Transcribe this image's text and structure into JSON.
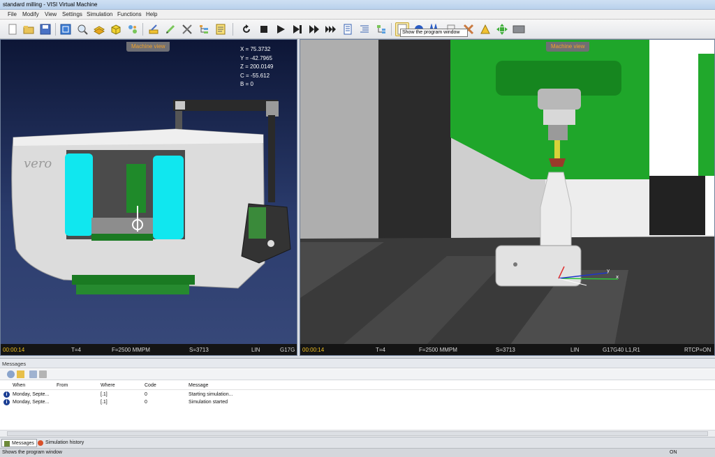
{
  "window": {
    "title": "standard milling - VISI Virtual Machine"
  },
  "menu": [
    "File",
    "Modify",
    "View",
    "Settings",
    "Simulation",
    "Functions",
    "Help"
  ],
  "tooltip": "Show the program window",
  "left_view": {
    "label": "Machine view",
    "brand": "vero",
    "coords": [
      "X = 75.3732",
      "Y = -42.7965",
      "Z = 200.0149",
      "C = -55.612",
      "B = 0"
    ],
    "status": {
      "time": "00:00:14",
      "tool": "T=4",
      "feed": "F=2500 MMPM",
      "speed": "S=3713",
      "mode": "LIN",
      "gcode": "G17G"
    }
  },
  "right_view": {
    "label": "Machine view",
    "axes": {
      "x": "x",
      "y": "y"
    },
    "status": {
      "time": "00:00:14",
      "tool": "T=4",
      "feed": "F=2500 MMPM",
      "speed": "S=3713",
      "mode": "LIN",
      "gcode": "G17G40 L1,R1",
      "rtcp": "RTCP=ON"
    }
  },
  "messages": {
    "title": "Messages",
    "columns": [
      "When",
      "From",
      "Where",
      "Code",
      "Message"
    ],
    "rows": [
      {
        "when": "Monday, Septe...",
        "from": "",
        "where": "[.1]",
        "code": "0",
        "message": "Starting simulation..."
      },
      {
        "when": "Monday, Septe...",
        "from": "",
        "where": "[.1]",
        "code": "0",
        "message": "Simulation started"
      }
    ]
  },
  "tabs": [
    "Messages",
    "Simulation history"
  ],
  "status_bar": {
    "text": "Shows the program window",
    "state": "ON"
  }
}
